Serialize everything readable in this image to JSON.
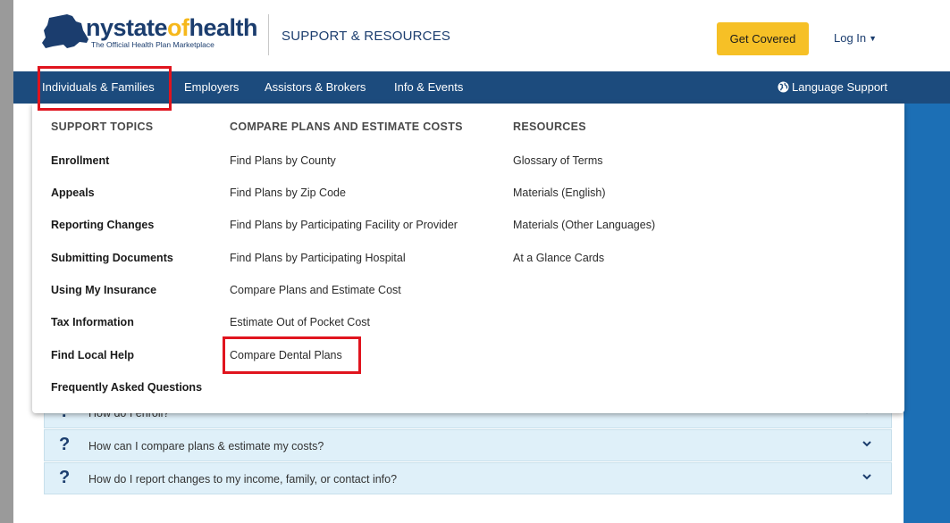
{
  "header": {
    "brand_part1": "nystate",
    "brand_part2": "of",
    "brand_part3": "health",
    "brand_tagline": "The Official Health Plan Marketplace",
    "section_title": "SUPPORT & RESOURCES",
    "get_covered_label": "Get Covered",
    "login_label": "Log In"
  },
  "nav": {
    "items": [
      {
        "label": "Individuals & Families"
      },
      {
        "label": "Employers"
      },
      {
        "label": "Assistors & Brokers"
      },
      {
        "label": "Info & Events"
      }
    ],
    "language_label": "Language Support"
  },
  "dropdown": {
    "columns": [
      {
        "heading": "SUPPORT TOPICS",
        "links": [
          "Enrollment",
          "Appeals",
          "Reporting Changes",
          "Submitting Documents",
          "Using My Insurance",
          "Tax Information",
          "Find Local Help",
          "Frequently Asked Questions"
        ]
      },
      {
        "heading": "COMPARE PLANS AND ESTIMATE COSTS",
        "links": [
          "Find Plans by County",
          "Find Plans by Zip Code",
          "Find Plans by Participating Facility or Provider",
          "Find Plans by Participating Hospital",
          "Compare Plans and Estimate Cost",
          "Estimate Out of Pocket Cost",
          "Compare Dental Plans"
        ]
      },
      {
        "heading": "RESOURCES",
        "links": [
          "Glossary of Terms",
          "Materials (English)",
          "Materials (Other Languages)",
          "At a Glance Cards"
        ]
      }
    ]
  },
  "faq": {
    "items": [
      {
        "question": "How do I enroll?"
      },
      {
        "question": "How can I compare plans & estimate my costs?"
      },
      {
        "question": "How do I report changes to my income, family, or contact info?"
      }
    ]
  },
  "colors": {
    "nav_bg": "#1c4b7d",
    "brand_blue": "#1b3d6e",
    "brand_gold": "#f6b81c",
    "button_yellow": "#f6c026",
    "highlight_red": "#e0141e",
    "faq_bg": "#dff0f9"
  },
  "icons": [
    "ny-state-map-icon",
    "caret-down-icon",
    "globe-icon",
    "question-mark-icon",
    "chevron-down-icon"
  ]
}
